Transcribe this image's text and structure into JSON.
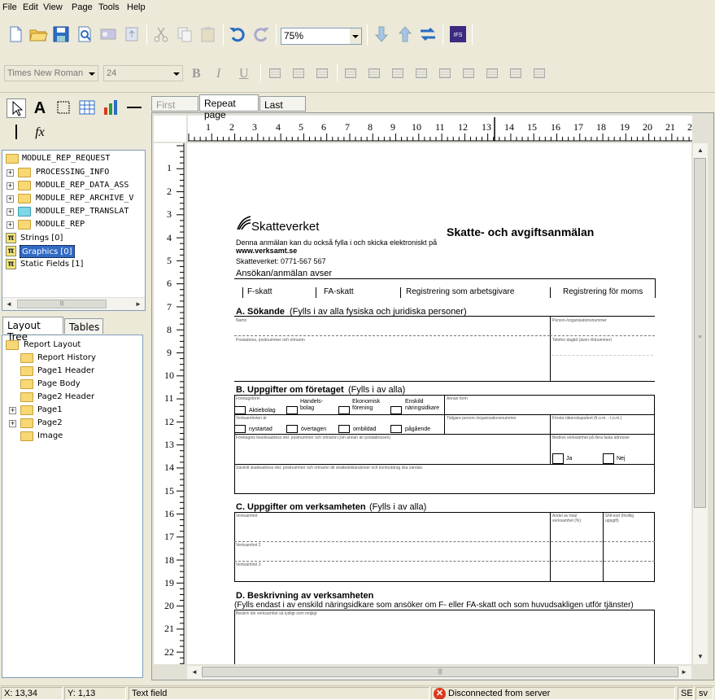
{
  "menu": [
    "File",
    "Edit",
    "View",
    "Page",
    "Tools",
    "Help"
  ],
  "zoom": "75%",
  "format": {
    "font": "Times New Roman",
    "size": "24"
  },
  "palette": {
    "fx": "fx"
  },
  "tree1": {
    "root": "MODULE_REP_REQUEST",
    "children": [
      "PROCESSING_INFO",
      "MODULE_REP_DATA_ASS",
      "MODULE_REP_ARCHIVE_V",
      "MODULE_REP_TRANSLAT",
      "MODULE_REP"
    ],
    "strings": "Strings [0]",
    "graphics": "Graphics [0]",
    "static_fields": "Static Fields [1]"
  },
  "left_tabs": [
    "Layout Tree",
    "Tables"
  ],
  "tree2": {
    "root": "Report Layout",
    "items": [
      "Report History",
      "Page1 Header",
      "Page Body",
      "Page2 Header",
      "Page1",
      "Page2",
      "Image"
    ]
  },
  "page_tabs": [
    "First page",
    "Repeat page",
    "Last page"
  ],
  "ruler": {
    "h": [
      "1",
      "2",
      "3",
      "4",
      "5",
      "6",
      "7",
      "8",
      "9",
      "10",
      "11",
      "12",
      "13",
      "14",
      "15",
      "16",
      "17",
      "18",
      "19",
      "20",
      "21",
      "2"
    ],
    "v": [
      "1",
      "2",
      "3",
      "4",
      "5",
      "6",
      "7",
      "8",
      "9",
      "10",
      "11",
      "12",
      "13",
      "14",
      "15",
      "16",
      "17",
      "18",
      "19",
      "20",
      "21",
      "22"
    ]
  },
  "form": {
    "logo": "Skatteverket",
    "title": "Skatte- och avgiftsanmälan",
    "intro1": "Denna anmälan kan du också fylla i och skicka elektroniskt på",
    "intro2": "www.verksamt.se",
    "intro3": "Skatteverket: 0771-567 567",
    "apply_heading": "Ansökan/anmälan avser",
    "opt1": "F-skatt",
    "opt2": "FA-skatt",
    "opt3": "Registrering som arbetsgivare",
    "opt4": "Registrering för moms",
    "secA": "A.  Sökande",
    "secA_note": "(Fylls i av alla fysiska och juridiska personer)",
    "name": "Namn",
    "pnr": "Person-/organisationsnummer",
    "post": "Postadress, postnummer och ortnamn",
    "tel": "Telefon dagtid (även riktnummer)",
    "secB": "B.  Uppgifter om företaget",
    "secB_note": "(Fylls i av alla)",
    "ftype": "Företagsform",
    "ab": "Aktiebolag",
    "hb": "Handels-\nbolag",
    "ef": "Ekonomisk\nförening",
    "en": "Enskild\nnäringsidkare",
    "other": "Annan form",
    "vb": "Verksamheten är",
    "ny": "nystartad",
    "ov": "övertagen",
    "om": "ombildad",
    "pa": "pågående",
    "prev": "Tidigare person-/organisationsnummer",
    "first": "Första räkenskapsåret (fr.o.m. - t.o.m.)",
    "addr": "Företagets besöksadress inkl. postnummer och ortnamn (om annan än postadressen)",
    "more": "Bedrivs verksamhet på flera fasta adresser",
    "ja": "Ja",
    "nej": "Nej",
    "special": "Särskilt skatteadress inkl. postnummer och ortnamn dit skattedeklarationer och kontoutdrag ska sändas",
    "secC": "C.  Uppgifter om verksamheten",
    "secC_note": "(Fylls i av alla)",
    "vs1": "Verksamhet",
    "andel": "Andel av total\nverksamhet (%)",
    "sni": "SNI-kod (frivillig\nuppgift)",
    "vs2": "Verksamhet 2",
    "vs3": "Verksamhet 3",
    "secD": "D.  Beskrivning av verksamheten",
    "secD_note": "(Fylls endast i av enskild näringsidkare som ansöker om F- eller FA-skatt och som huvudsakligen utför tjänster)",
    "desc": "Beskriv din verksamhet så tydligt som möjligt"
  },
  "status": {
    "x": "X: 13,34",
    "y": "Y: 1,13",
    "field": "Text field",
    "conn": "Disconnected from server",
    "locale": "SE",
    "lang": "sv"
  },
  "colors": {
    "selection": "#316ac5",
    "toolbar_blue": "#2b6cc4",
    "error": "#d93a1f"
  }
}
